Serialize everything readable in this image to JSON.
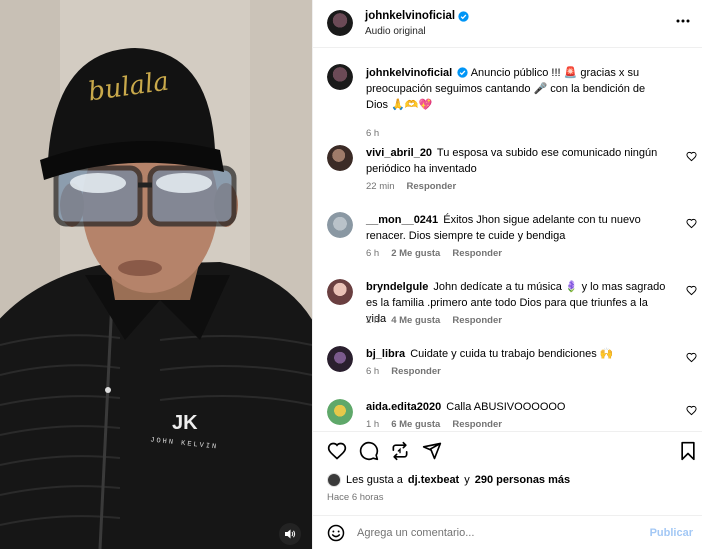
{
  "colors": {
    "accent": "#0095f6",
    "verified": "#0095f6",
    "muted": "#737373",
    "publish_disabled": "#a3c8f5",
    "heart_red": "#ed4956"
  },
  "video": {
    "cap_text": "bulala",
    "jacket_logo": "JK",
    "jacket_text": "JOHN KELVIN",
    "mute_icon": "speaker-icon"
  },
  "header": {
    "username": "johnkelvinoficial",
    "subtitle": "Audio original",
    "more_icon": "more-horizontal-icon"
  },
  "caption": {
    "username": "johnkelvinoficial",
    "text": "Anuncio público !!! 🚨 gracias x su preocupación seguimos cantando 🎤 con la bendición de Dios 🙏🫶💖",
    "time": "6 h"
  },
  "comments": [
    {
      "username": "vivi_abril_20",
      "text": "Tu esposa va subido ese comunicado ningún periódico ha inventado",
      "time": "22 min",
      "likes": "",
      "reply": "Responder"
    },
    {
      "username": "__mon__0241",
      "text": "Éxitos Jhon sigue adelante con tu nuevo renacer. Dios siempre te cuide y bendiga",
      "time": "6 h",
      "likes": "2 Me gusta",
      "reply": "Responder"
    },
    {
      "username": "bryndelgule",
      "text": "John dedícate a tu música 🪻 y lo mas sagrado es la familia .primero ante todo Dios para que triunfes a la vida",
      "time": "2 h",
      "likes": "4 Me gusta",
      "reply": "Responder"
    },
    {
      "username": "bj_libra",
      "text": "Cuidate y cuida tu trabajo bendiciones 🙌",
      "time": "6 h",
      "likes": "",
      "reply": "Responder"
    },
    {
      "username": "aida.edita2020",
      "text": "Calla ABUSIVOOOOOO",
      "time": "1 h",
      "likes": "6 Me gusta",
      "reply": "Responder"
    }
  ],
  "actions": {
    "like_icon": "heart-icon",
    "comment_icon": "comment-icon",
    "repost_icon": "repost-icon",
    "share_icon": "share-icon",
    "save_icon": "bookmark-icon"
  },
  "likes": {
    "prefix": "Les gusta a",
    "user": "dj.texbeat",
    "middle": "y",
    "others": "290 personas más"
  },
  "posted": "Hace 6 horas",
  "composer": {
    "placeholder": "Agrega un comentario...",
    "publish": "Publicar",
    "emoji_icon": "emoji-icon"
  }
}
